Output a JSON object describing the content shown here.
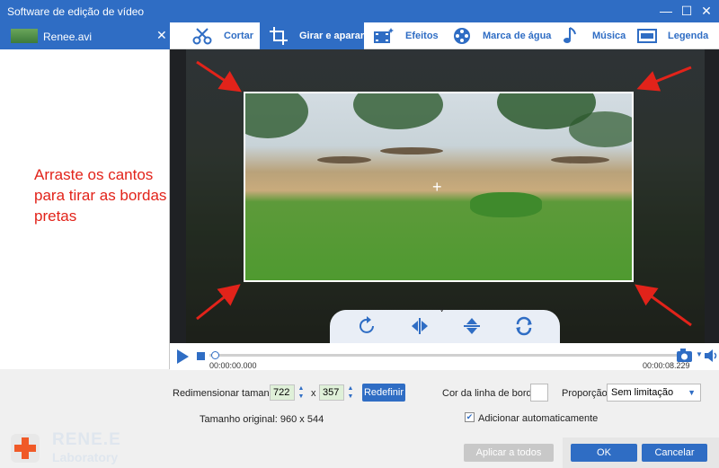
{
  "window": {
    "title": "Software de edição de vídeo",
    "minimize": "—",
    "maximize": "☐",
    "close": "✕"
  },
  "sidebar": {
    "file_name": "Renee.avi",
    "close": "✕"
  },
  "instruction": "Arraste os cantos para tirar as bordas pretas",
  "tabs": [
    {
      "label": "Cortar",
      "icon": "scissors-icon"
    },
    {
      "label": "Girar e aparar",
      "icon": "crop-icon"
    },
    {
      "label": "Efeitos",
      "icon": "film-effects-icon"
    },
    {
      "label": "Marca de água",
      "icon": "film-reel-icon"
    },
    {
      "label": "Música",
      "icon": "music-note-icon"
    },
    {
      "label": "Legenda",
      "icon": "subtitle-icon"
    }
  ],
  "colors": {
    "accent": "#2f6dc4",
    "arrow": "#e2231a"
  },
  "player": {
    "current_time": "00:00:00.000",
    "end_time": "00:00:08.229",
    "progress": 0.0
  },
  "resize": {
    "label": "Redimensionar tamanho:",
    "width": "722",
    "separator": "x",
    "height": "357",
    "reset": "Redefinir"
  },
  "original_size": "Tamanho original: 960 x 544",
  "border_color_label": "Cor da linha de borda:",
  "ratio": {
    "label": "Proporção:",
    "value": "Sem limitação"
  },
  "auto_add": {
    "label": "Adicionar automaticamente",
    "checked": true
  },
  "buttons": {
    "apply_all": "Aplicar a todos",
    "ok": "OK",
    "cancel": "Cancelar"
  },
  "logo": {
    "line1": "RENE.E",
    "line2": "Laboratory"
  }
}
